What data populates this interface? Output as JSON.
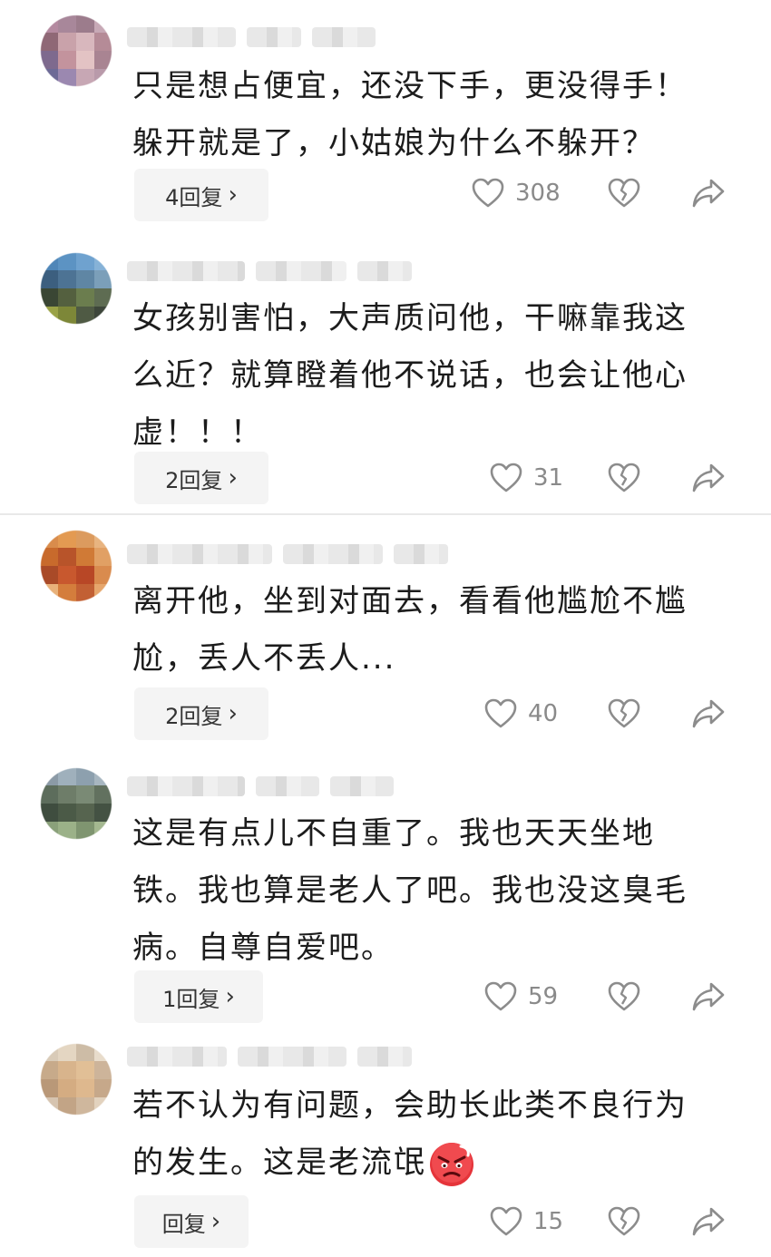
{
  "colors": {
    "icon_stroke": "#8c8c8c",
    "count_text": "#8a8a8a",
    "reply_bg": "#f4f4f4",
    "emoji_red": "#e5343a"
  },
  "comments": [
    {
      "avatar_icon": "blurred-avatar",
      "text": "只是想占便宜，还没下手，更没得手！\n躲开就是了，小姑娘为什么不躲开？",
      "reply_label": "4回复",
      "likes": "308"
    },
    {
      "avatar_icon": "blurred-avatar",
      "text": "女孩别害怕，大声质问他，干嘛靠我这\n么近？就算瞪着他不说话，也会让他心\n虚！！！",
      "reply_label": "2回复",
      "likes": "31"
    },
    {
      "avatar_icon": "blurred-avatar",
      "text": "离开他，坐到对面去，看看他尴尬不尴\n尬，丢人不丢人...",
      "reply_label": "2回复",
      "likes": "40"
    },
    {
      "avatar_icon": "blurred-avatar",
      "text": "这是有点儿不自重了。我也天天坐地\n铁。我也算是老人了吧。我也没这臭毛\n病。自尊自爱吧。",
      "reply_label": "1回复",
      "likes": "59"
    },
    {
      "avatar_icon": "blurred-avatar",
      "text": "若不认为有问题，会助长此类不良行为\n的发生。这是老流氓",
      "trailing_emoji": "angry-face-emoji",
      "reply_label": "回复",
      "likes": "15"
    }
  ],
  "icons": {
    "reply_chevron": "›",
    "like": "heart-outline-icon",
    "dislike": "broken-heart-icon",
    "share": "share-arrow-icon"
  }
}
